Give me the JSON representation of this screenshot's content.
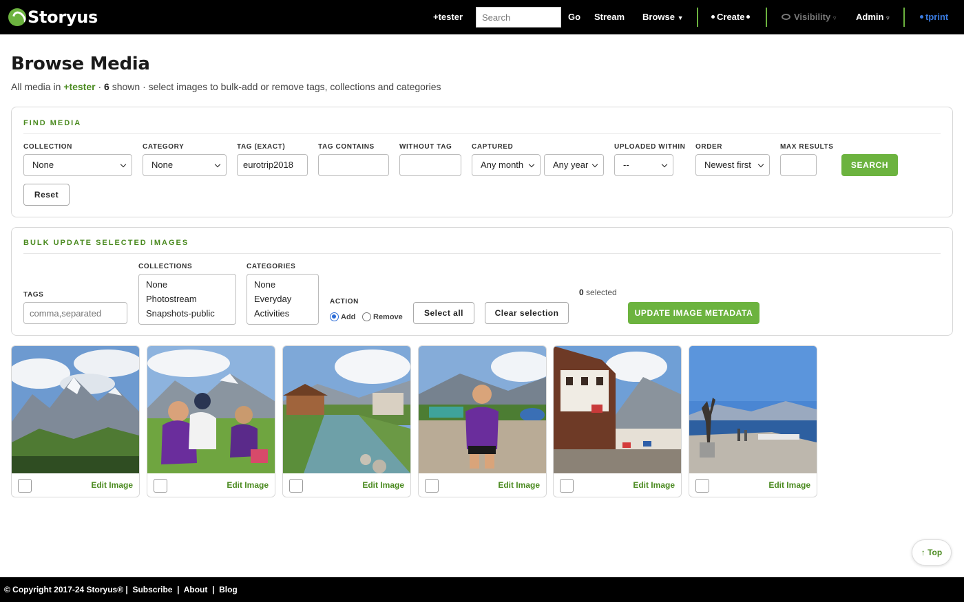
{
  "nav": {
    "brand": "Storyus",
    "user": "+tester",
    "search_placeholder": "Search",
    "go": "Go",
    "stream": "Stream",
    "browse": "Browse",
    "create": "Create",
    "visibility": "Visibility",
    "admin": "Admin",
    "account": "tprint"
  },
  "header": {
    "title": "Browse Media",
    "sub_prefix": "All media in",
    "sub_user": "+tester",
    "sub_sep": " · ",
    "sub_count": "6",
    "sub_suffix": " shown · select images to bulk-add or remove tags, collections and categories"
  },
  "find": {
    "title": "FIND MEDIA",
    "collection_label": "COLLECTION",
    "collection_value": "None",
    "category_label": "CATEGORY",
    "category_value": "None",
    "tag_exact_label": "TAG (EXACT)",
    "tag_exact_value": "eurotrip2018",
    "tag_contains_label": "TAG CONTAINS",
    "tag_contains_value": "",
    "without_tag_label": "WITHOUT TAG",
    "without_tag_value": "",
    "captured_label": "CAPTURED",
    "captured_month": "Any month",
    "captured_year": "Any year",
    "uploaded_label": "UPLOADED WITHIN",
    "uploaded_value": "--",
    "order_label": "ORDER",
    "order_value": "Newest first",
    "max_label": "MAX RESULTS",
    "max_value": "",
    "search_button": "SEARCH",
    "reset_button": "Reset"
  },
  "bulk": {
    "title": "BULK UPDATE SELECTED IMAGES",
    "tags_label": "TAGS",
    "tags_placeholder": "comma,separated",
    "collections_label": "COLLECTIONS",
    "collections": [
      "None",
      "Photostream",
      "Snapshots-public"
    ],
    "categories_label": "CATEGORIES",
    "categories": [
      "None",
      "Everyday",
      "Activities"
    ],
    "action_label": "ACTION",
    "action_add": "Add",
    "action_remove": "Remove",
    "action_selected": "Add",
    "select_all": "Select all",
    "clear_selection": "Clear selection",
    "selected_count": "0",
    "selected_text": "selected",
    "update_button": "UPDATE IMAGE METADATA"
  },
  "gallery": {
    "edit_label": "Edit Image",
    "items": [
      {
        "subject": "mountain-meadow-photo"
      },
      {
        "subject": "kids-picnic-photo"
      },
      {
        "subject": "river-village-photo"
      },
      {
        "subject": "boy-scout-photo"
      },
      {
        "subject": "village-street-photo"
      },
      {
        "subject": "lakeside-statue-photo"
      }
    ]
  },
  "top_button": "Top",
  "footer": {
    "copyright": "© Copyright 2017-24 Storyus®",
    "subscribe": "Subscribe",
    "about": "About",
    "blog": "Blog",
    "sep": "|"
  },
  "colors": {
    "brand_green": "#6cb33f",
    "label_green": "#4a8a1f",
    "nav_bg": "#000000",
    "account_blue": "#3a7be0"
  }
}
